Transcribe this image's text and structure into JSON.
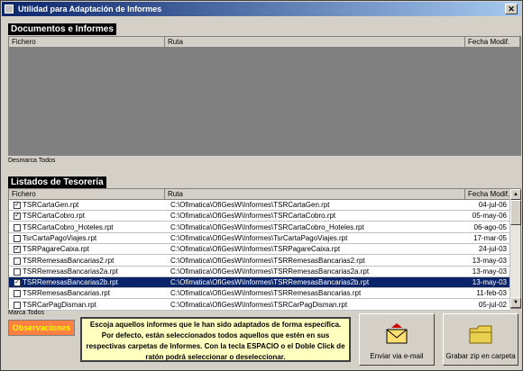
{
  "window": {
    "title": "Utilidad para Adaptación de Informes",
    "close_label": "✕"
  },
  "doc_section": {
    "title": "Documentos e Informes",
    "columns": [
      "Fichero",
      "Ruta",
      "Fecha Modif."
    ],
    "toggle_label": "Desmarca Todos"
  },
  "tes_section": {
    "title": "Listados de Tesorería",
    "columns": [
      "Fichero",
      "Ruta",
      "Fecha Modif."
    ],
    "rows": [
      {
        "checked": true,
        "file": "TSRCartaGen.rpt",
        "path": "C:\\Ofimatica\\OfiGesW\\Informes\\TSRCartaGen.rpt",
        "date": "04-jul-06"
      },
      {
        "checked": true,
        "file": "TSRCartaCobro.rpt",
        "path": "C:\\Ofimatica\\OfiGesW\\Informes\\TSRCartaCobro.rpt",
        "date": "05-may-06"
      },
      {
        "checked": false,
        "file": "TSRCartaCobro_Hoteles.rpt",
        "path": "C:\\Ofimatica\\OfiGesW\\Informes\\TSRCartaCobro_Hoteles.rpt",
        "date": "06-ago-05"
      },
      {
        "checked": false,
        "file": "TsrCartaPagoViajes.rpt",
        "path": "C:\\Ofimatica\\OfiGesW\\Informes\\TsrCartaPagoViajes.rpt",
        "date": "17-mar-05"
      },
      {
        "checked": true,
        "file": "TSRPagareCaixa.rpt",
        "path": "C:\\Ofimatica\\OfiGesW\\Informes\\TSRPagareCaixa.rpt",
        "date": "24-jul-03"
      },
      {
        "checked": false,
        "file": "TSRRemesasBancarias2.rpt",
        "path": "C:\\Ofimatica\\OfiGesW\\Informes\\TSRRemesasBancarias2.rpt",
        "date": "13-may-03"
      },
      {
        "checked": false,
        "file": "TSRRemesasBancarias2a.rpt",
        "path": "C:\\Ofimatica\\OfiGesW\\Informes\\TSRRemesasBancarias2a.rpt",
        "date": "13-may-03"
      },
      {
        "checked": true,
        "file": "TSRRemesasBancarias2b.rpt",
        "path": "C:\\Ofimatica\\OfiGesW\\Informes\\TSRRemesasBancarias2b.rpt",
        "date": "13-may-03",
        "selected": true
      },
      {
        "checked": false,
        "file": "TSRRemesasBancarias.rpt",
        "path": "C:\\Ofimatica\\OfiGesW\\Informes\\TSRRemesasBancarias.rpt",
        "date": "11-feb-03"
      },
      {
        "checked": false,
        "file": "TSRCarPagDisman.rpt",
        "path": "C:\\Ofimatica\\OfiGesW\\Informes\\TSRCarPagDisman.rpt",
        "date": "05-jul-02"
      }
    ],
    "toggle_label": "Marca Todos"
  },
  "footer": {
    "observaciones_label": "Observaciones",
    "info_text": "Escoja aquellos informes que le han sido adaptados de forma específica. Por defecto, están seleccionados todos aquellos que estén en sus respectivas carpetas de Informes. Con la tecla ESPACIO o el Doble Click de ratón podrá seleccionar o deseleccionar.",
    "email_label": "Enviar via e-mail",
    "zip_label": "Grabar zip en carpeta"
  }
}
